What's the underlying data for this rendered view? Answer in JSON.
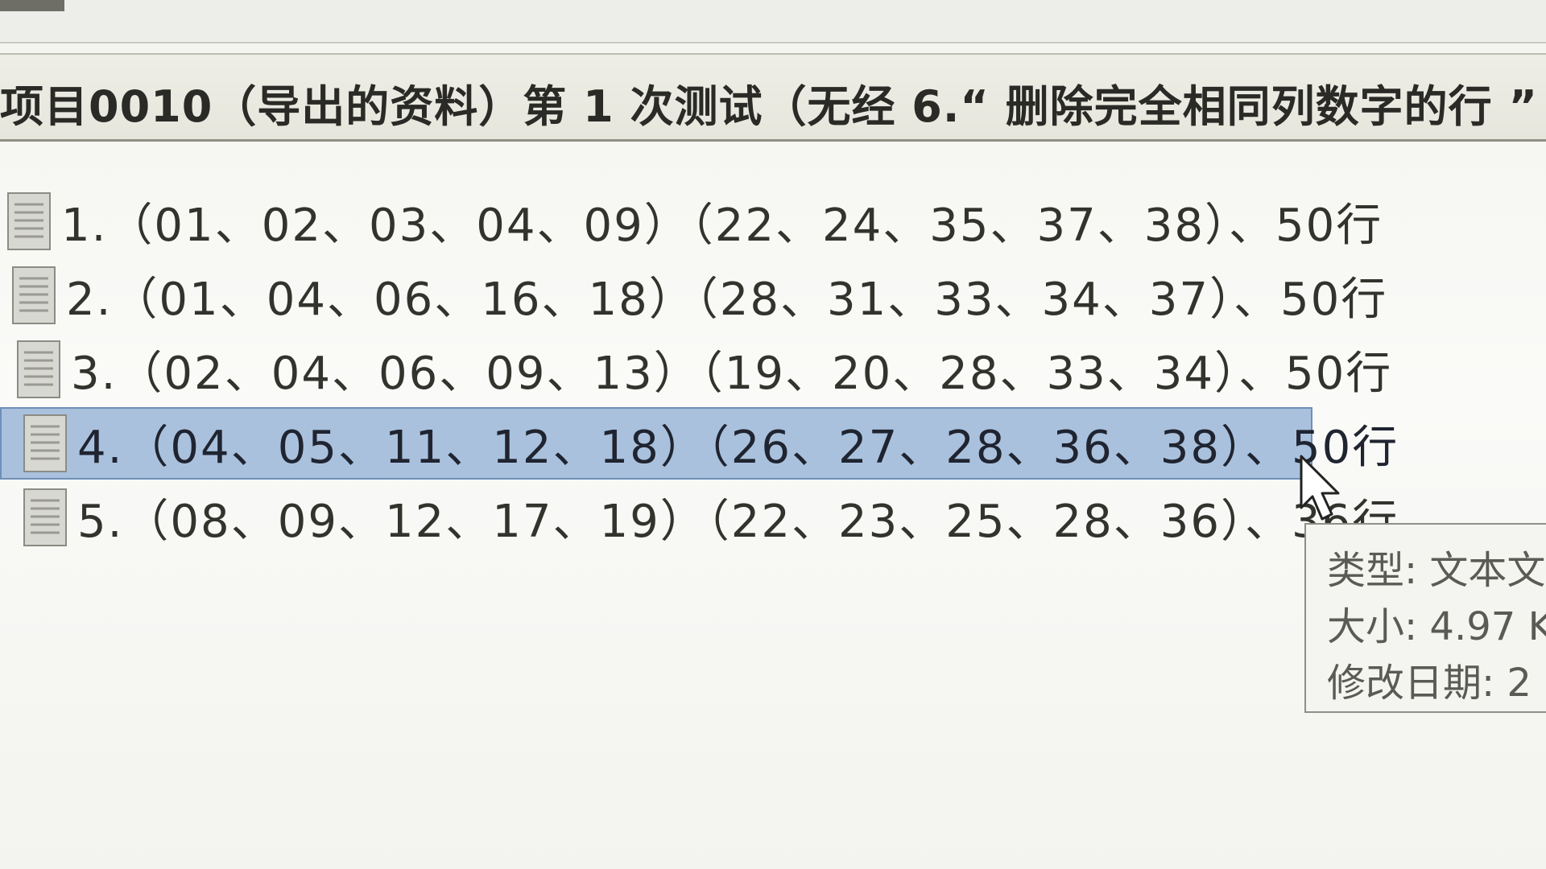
{
  "window": {
    "title": "项目0010（导出的资料）第 1 次测试（无经 6.“ 删除完全相同列数字的行 ” 的"
  },
  "files": [
    {
      "label": "1.（01、02、03、04、09）（22、24、35、37、38）、50行"
    },
    {
      "label": "2.（01、04、06、16、18）（28、31、33、34、37）、50行"
    },
    {
      "label": "3.（02、04、06、09、13）（19、20、28、33、34）、50行"
    },
    {
      "label": "4.（04、05、11、12、18）（26、27、28、36、38）、50行"
    },
    {
      "label": "5.（08、09、12、17、19）（22、23、25、28、36）、36行"
    }
  ],
  "selected_index": 3,
  "tooltip": {
    "type_line": "类型: 文本文",
    "size_line": "大小: 4.97 K",
    "date_line": "修改日期: 2"
  },
  "icons": {
    "file": "text-file-icon",
    "cursor": "mouse-pointer-icon"
  },
  "colors": {
    "selection_fill": "#a9c1dd",
    "selection_border": "#6e8fb8",
    "text": "#33332e"
  }
}
